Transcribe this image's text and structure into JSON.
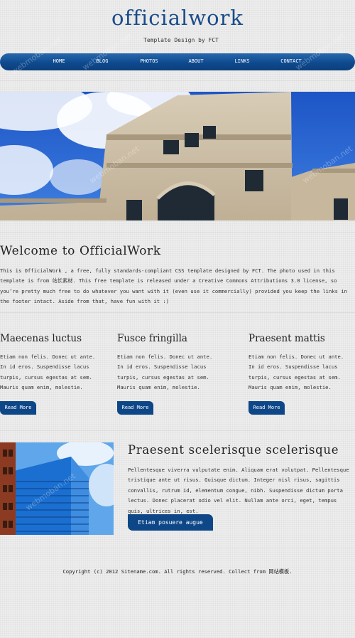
{
  "header": {
    "site_title": "officialwork",
    "tagline": "Template Design by FCT"
  },
  "nav": {
    "items": [
      {
        "label": "HOME"
      },
      {
        "label": "BLOG"
      },
      {
        "label": "PHOTOS"
      },
      {
        "label": "ABOUT"
      },
      {
        "label": "LINKS"
      },
      {
        "label": "CONTACT"
      }
    ]
  },
  "welcome": {
    "title": "Welcome to OfficialWork",
    "body": "This is OfficialWork , a free, fully standards-compliant CSS template designed by FCT. The photo used in this template is from 站长素材. This free template is released under a Creative Commons Attributions 3.0 license, so you’re pretty much free to do whatever you want with it (even use it commercially) provided you keep the links in the footer intact. Aside from that, have fun with it :)"
  },
  "columns": [
    {
      "title": "Maecenas luctus",
      "body": "Etiam non felis. Donec ut ante. In id eros. Suspendisse lacus turpis, cursus egestas at sem. Mauris quam enim, molestie.",
      "button": "Read More"
    },
    {
      "title": "Fusce fringilla",
      "body": "Etiam non felis. Donec ut ante. In id eros. Suspendisse lacus turpis, cursus egestas at sem. Mauris quam enim, molestie.",
      "button": "Read More"
    },
    {
      "title": "Praesent mattis",
      "body": "Etiam non felis. Donec ut ante. In id eros. Suspendisse lacus turpis, cursus egestas at sem. Mauris quam enim, molestie.",
      "button": "Read More"
    }
  ],
  "feature": {
    "title": "Praesent scelerisque scelerisque",
    "body": "Pellentesque viverra vulputate enim. Aliquam erat volutpat. Pellentesque tristique ante ut risus. Quisque dictum. Integer nisl risus, sagittis convallis, rutrum id, elementum congue, nibh. Suspendisse dictum porta lectus. Donec placerat odio vel elit. Nullam ante orci, eget, tempus quis, ultrices in, est.",
    "button": "Etiam posuere augue"
  },
  "footer": {
    "text": "Copyright (c) 2012 Sitename.com. All rights reserved. Collect from 网站模板."
  },
  "watermark": "webmoban.net",
  "colors": {
    "brand_blue": "#1a4c8a",
    "nav_blue": "#0f4a8f",
    "button_blue": "#0e4787",
    "background": "#ededed"
  }
}
